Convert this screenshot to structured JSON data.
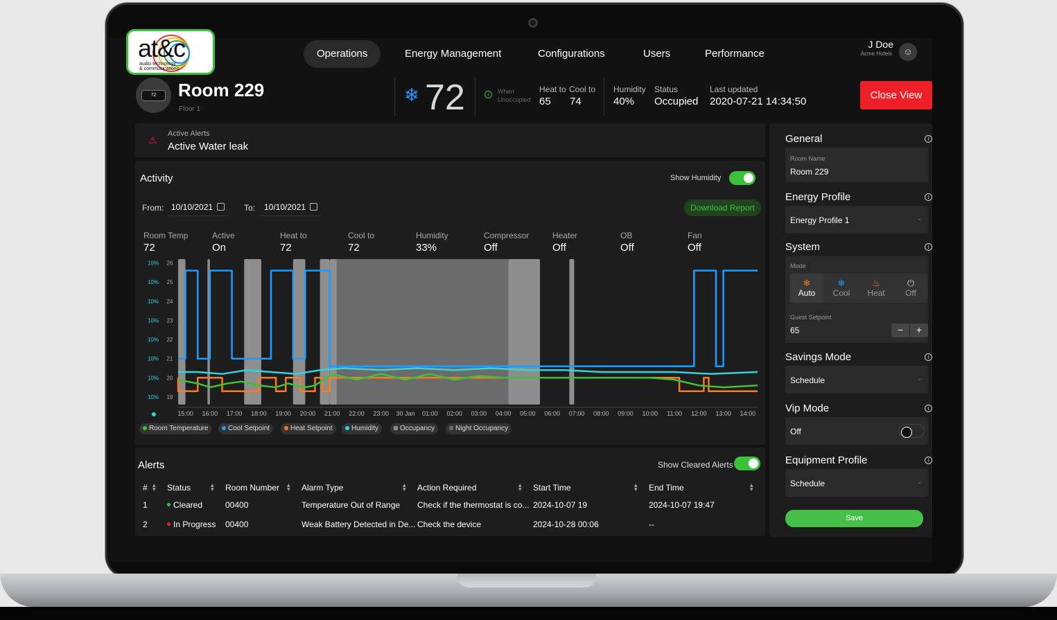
{
  "logo": {
    "brand": "at&c",
    "sub1": "audio technology",
    "sub2": "& communications"
  },
  "nav": {
    "items": [
      "Operations",
      "Energy Management",
      "Configurations",
      "Users",
      "Performance"
    ],
    "active": "Operations"
  },
  "user": {
    "name": "J Doe",
    "org": "Acme Hotels",
    "icon": "user-icon"
  },
  "room": {
    "title": "Room 229",
    "floor": "Floor 1",
    "thermostat_display": "72",
    "current_temp": "72",
    "mode_icon": "snowflake-icon",
    "when_unoccupied": [
      "When",
      "Unoccupied"
    ],
    "heat_to_label": "Heat to",
    "heat_to": "65",
    "cool_to_label": "Cool to",
    "cool_to": "74",
    "humidity_label": "Humidity",
    "humidity": "40%",
    "status_label": "Status",
    "status": "Occupied",
    "last_updated_label": "Last updated",
    "last_updated": "2020-07-21 14:34:50",
    "close_label": "Close View"
  },
  "active_alert": {
    "label": "Active Alerts",
    "value": "Active Water leak"
  },
  "activity": {
    "title": "Activity",
    "show_humidity_label": "Show Humidity",
    "show_humidity": true,
    "from_label": "From:",
    "from_date": "10/10/2021",
    "to_label": "To:",
    "to_date": "10/10/2021",
    "download_label": "Download Report",
    "metrics": [
      {
        "label": "Room Temp",
        "value": "72"
      },
      {
        "label": "Active",
        "value": "On"
      },
      {
        "label": "Heat to",
        "value": "72"
      },
      {
        "label": "Cool to",
        "value": "72"
      },
      {
        "label": "Humidity",
        "value": "33%"
      },
      {
        "label": "Compressor",
        "value": "Off"
      },
      {
        "label": "Heater",
        "value": "Off"
      },
      {
        "label": "OB",
        "value": "Off"
      },
      {
        "label": "Fan",
        "value": "Off"
      }
    ],
    "legend": [
      {
        "name": "Room Temperature",
        "color": "#3cc23a"
      },
      {
        "name": "Cool Setpoint",
        "color": "#1e9bff"
      },
      {
        "name": "Heat Setpoint",
        "color": "#ff7a1a"
      },
      {
        "name": "Humidity",
        "color": "#2fd5e0"
      },
      {
        "name": "Occupancy",
        "color": "#8a8a8a"
      },
      {
        "name": "Night Occupancy",
        "color": "#555555"
      }
    ]
  },
  "chart_data": {
    "type": "line",
    "x": [
      "15:00",
      "16:00",
      "17:00",
      "18:00",
      "19:00",
      "20:00",
      "21:00",
      "22:00",
      "23:00",
      "30 Jan",
      "01:00",
      "02:00",
      "03:00",
      "04:00",
      "05:00",
      "06:00",
      "07:00",
      "08:00",
      "09:00",
      "10:00",
      "11:00",
      "12:00",
      "13:00",
      "14:00"
    ],
    "y_ticks": [
      "26",
      "25",
      "24",
      "23",
      "22",
      "21",
      "20",
      "19"
    ],
    "humidity_ticks": [
      "10%",
      "10%",
      "10%",
      "10%",
      "10%",
      "10%",
      "10%",
      "10%"
    ],
    "ylim": [
      18.6,
      26.2
    ],
    "x_range": [
      14.7,
      38.4
    ],
    "series": [
      {
        "name": "Cool Setpoint",
        "color": "#1e9bff",
        "points": [
          [
            14.7,
            21
          ],
          [
            15.0,
            21
          ],
          [
            15.0,
            25.6
          ],
          [
            15.5,
            25.6
          ],
          [
            15.5,
            21
          ],
          [
            16.0,
            21
          ],
          [
            16.0,
            25.6
          ],
          [
            16.9,
            25.6
          ],
          [
            16.9,
            21
          ],
          [
            18.5,
            21
          ],
          [
            18.5,
            25.6
          ],
          [
            19.4,
            25.6
          ],
          [
            19.4,
            21
          ],
          [
            19.9,
            21
          ],
          [
            19.9,
            25.6
          ],
          [
            20.9,
            25.6
          ],
          [
            20.9,
            20.6
          ],
          [
            35.8,
            20.6
          ],
          [
            35.8,
            25.6
          ],
          [
            36.7,
            25.6
          ],
          [
            36.7,
            20.6
          ],
          [
            37.0,
            20.6
          ],
          [
            37.0,
            25.6
          ],
          [
            38.4,
            25.6
          ]
        ]
      },
      {
        "name": "Humidity",
        "color": "#2fd5e0",
        "points": [
          [
            14.7,
            20.3
          ],
          [
            15.5,
            20.3
          ],
          [
            16.5,
            20.2
          ],
          [
            17.5,
            20.4
          ],
          [
            18.5,
            20.3
          ],
          [
            19.5,
            20.2
          ],
          [
            20.5,
            20.4
          ],
          [
            21.5,
            20.5
          ],
          [
            23,
            20.4
          ],
          [
            24.5,
            20.5
          ],
          [
            26,
            20.4
          ],
          [
            27.5,
            20.5
          ],
          [
            29,
            20.4
          ],
          [
            30.5,
            20.4
          ],
          [
            32,
            20.3
          ],
          [
            33.5,
            20.3
          ],
          [
            35,
            20.3
          ],
          [
            36.5,
            20.2
          ],
          [
            38.4,
            20.3
          ]
        ]
      },
      {
        "name": "Heat Setpoint",
        "color": "#ff7a1a",
        "points": [
          [
            14.7,
            20
          ],
          [
            14.7,
            19.3
          ],
          [
            15.5,
            19.3
          ],
          [
            15.5,
            20
          ],
          [
            16.5,
            20
          ],
          [
            16.5,
            19.3
          ],
          [
            18.0,
            19.3
          ],
          [
            18.0,
            20
          ],
          [
            18.7,
            20
          ],
          [
            18.7,
            19.3
          ],
          [
            19.1,
            19.3
          ],
          [
            19.1,
            20
          ],
          [
            19.7,
            20
          ],
          [
            19.7,
            19.3
          ],
          [
            20.3,
            19.3
          ],
          [
            20.3,
            20
          ],
          [
            20.6,
            20
          ],
          [
            20.6,
            19.3
          ],
          [
            20.9,
            19.3
          ],
          [
            20.9,
            20
          ],
          [
            35.2,
            20
          ],
          [
            35.2,
            19.3
          ],
          [
            36.2,
            19.3
          ],
          [
            36.2,
            20
          ],
          [
            36.4,
            20
          ],
          [
            36.4,
            19.3
          ],
          [
            38.4,
            19.3
          ]
        ]
      },
      {
        "name": "Room Temperature",
        "color": "#3cc23a",
        "points": [
          [
            14.7,
            19.9
          ],
          [
            15.5,
            19.7
          ],
          [
            16.0,
            19.5
          ],
          [
            16.7,
            19.7
          ],
          [
            17.3,
            19.8
          ],
          [
            18.0,
            19.6
          ],
          [
            18.7,
            19.5
          ],
          [
            19.2,
            19.7
          ],
          [
            19.9,
            19.5
          ],
          [
            20.3,
            19.6
          ],
          [
            21.0,
            20.2
          ],
          [
            22.0,
            19.9
          ],
          [
            23.0,
            20.2
          ],
          [
            24.0,
            19.9
          ],
          [
            25.0,
            20.2
          ],
          [
            26.0,
            19.9
          ],
          [
            27.0,
            20.1
          ],
          [
            28.0,
            20.0
          ],
          [
            30.0,
            20.0
          ],
          [
            32.0,
            20.0
          ],
          [
            34.0,
            20.0
          ],
          [
            35.0,
            19.9
          ],
          [
            36.0,
            19.6
          ],
          [
            37.0,
            19.5
          ],
          [
            38.4,
            19.6
          ]
        ]
      }
    ],
    "occupancy_spans": [
      [
        14.7,
        15.0
      ],
      [
        15.9,
        16.0
      ],
      [
        17.4,
        18.1
      ],
      [
        19.4,
        19.9
      ],
      [
        20.5,
        20.9
      ],
      [
        20.9,
        28.2
      ],
      [
        28.2,
        29.5
      ],
      [
        30.7,
        30.9
      ]
    ]
  },
  "alerts": {
    "title": "Alerts",
    "show_cleared_label": "Show Cleared Alerts",
    "show_cleared": true,
    "columns": [
      "#",
      "Status",
      "Room Number",
      "Alarm Type",
      "Action Required",
      "Start Time",
      "End Time"
    ],
    "rows": [
      {
        "num": "1",
        "status": "Cleared",
        "status_color": "#3cc23a",
        "room": "00400",
        "type": "Temperature Out of Range",
        "action": "Check if the thermostat is co...",
        "start": "2024-10-07 19",
        "end": "2024-10-07 19:47"
      },
      {
        "num": "2",
        "status": "In Progress",
        "status_color": "#ef1f27",
        "room": "00400",
        "type": "Weak Battery Detected in De...",
        "action": "Check the device",
        "start": "2024-10-28 00:06",
        "end": "--"
      }
    ]
  },
  "sidebar": {
    "general": {
      "title": "General",
      "room_name_label": "Room Name",
      "room_name": "Room 229"
    },
    "energy_profile": {
      "title": "Energy Profile",
      "value": "Energy Profile 1"
    },
    "system": {
      "title": "System",
      "mode_label": "Mode",
      "modes": [
        {
          "label": "Auto",
          "icon": "auto-mode-icon"
        },
        {
          "label": "Cool",
          "icon": "snowflake-icon"
        },
        {
          "label": "Heat",
          "icon": "flame-icon"
        },
        {
          "label": "Off",
          "icon": "power-icon"
        }
      ],
      "active_mode": "Auto",
      "guest_setpoint_label": "Guest Setpoint",
      "guest_setpoint": "65"
    },
    "savings_mode": {
      "title": "Savings Mode",
      "value": "Schedule"
    },
    "vip_mode": {
      "title": "Vip Mode",
      "value": "Off",
      "enabled": false
    },
    "equipment_profile": {
      "title": "Equipment Profile",
      "value": "Schedule"
    },
    "save_label": "Save"
  }
}
